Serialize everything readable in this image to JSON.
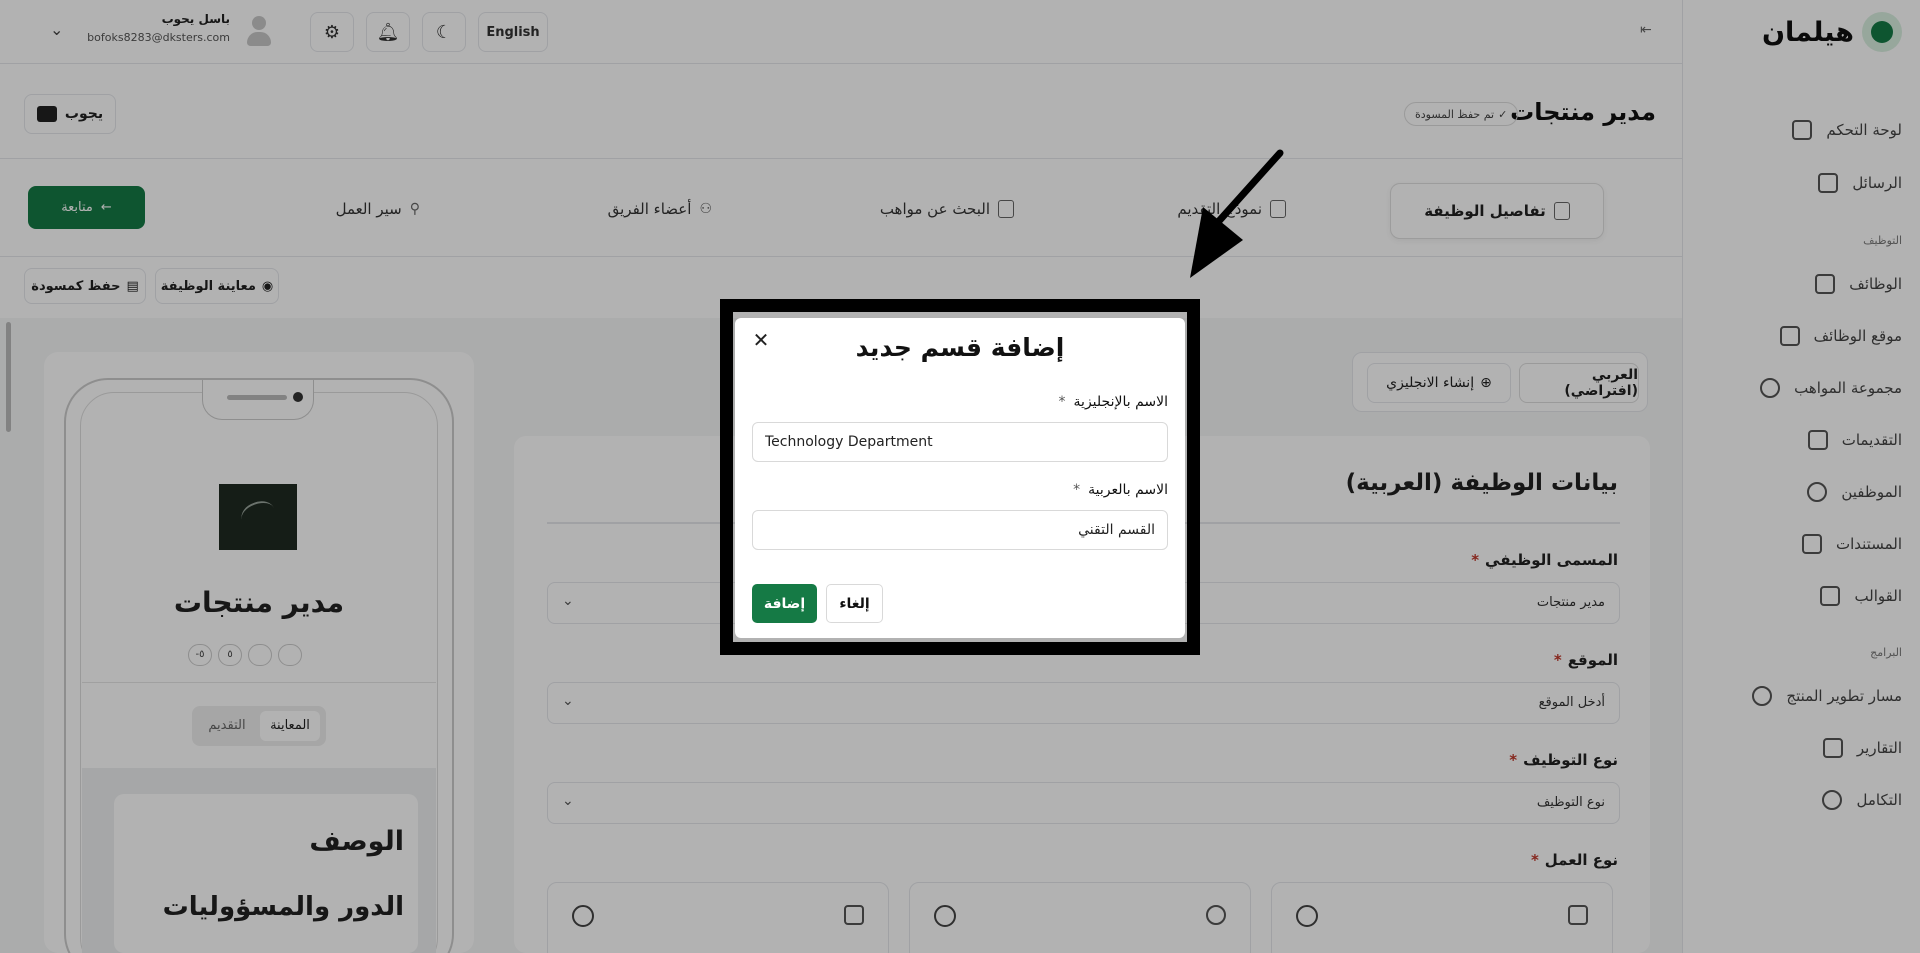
{
  "sidebar": {
    "brand": "هيلمان",
    "items": [
      {
        "label": "لوحة التحكم",
        "icon": "dashboard-icon"
      },
      {
        "label": "الرسائل",
        "icon": "mail-icon"
      },
      {
        "label": "الوظائف",
        "icon": "briefcase-icon"
      },
      {
        "label": "موقع الوظائف",
        "icon": "monitor-icon"
      },
      {
        "label": "مجموعة المواهب",
        "icon": "compass-icon"
      },
      {
        "label": "التقديمات",
        "icon": "store-icon"
      },
      {
        "label": "الموظفين",
        "icon": "person-icon"
      },
      {
        "label": "المستندات",
        "icon": "document-icon"
      },
      {
        "label": "القوالب",
        "icon": "template-icon"
      },
      {
        "label": "مسار تطوير المنتج",
        "icon": "hand-icon"
      },
      {
        "label": "التقارير",
        "icon": "filter-icon"
      },
      {
        "label": "التكامل",
        "icon": "link-icon"
      }
    ],
    "sections": [
      "التوظيف",
      "البرامج"
    ]
  },
  "topbar": {
    "language": "English",
    "user_name": "باسل يحوب",
    "user_email": "bofoks8283@dksters.com"
  },
  "page": {
    "title": "مدير منتجات",
    "draft_badge": "تم حفظ المسودة",
    "back_label": "يجوب"
  },
  "steps": {
    "active": "تفاصيل الوظيفة",
    "items": [
      "نموذج التقديم",
      "البحث عن مواهب",
      "أعضاء الفريق",
      "سير العمل"
    ],
    "next_label": "متابعة"
  },
  "actions": {
    "preview": "معاينة الوظيفة",
    "save_draft": "حفظ كمسودة"
  },
  "preview": {
    "title": "مدير منتجات",
    "chips": [
      "-٥",
      "٥",
      "",
      ""
    ],
    "tab_preview": "المعاينة",
    "tab_apply": "التقديم",
    "desc_heading": "الوصف",
    "role_heading": "الدور والمسؤوليات"
  },
  "form": {
    "lang_tab_default": "العربي (افتراضي)",
    "lang_tab_create": "إنشاء الانجليزي",
    "title": "بيانات الوظيفة (العربية)",
    "job_title_label": "المسمى الوظيفي",
    "job_title_value": "مدير منتجات",
    "location_label": "الموقع",
    "location_placeholder": "أدخل الموقع",
    "employment_type_label": "نوع التوظيف",
    "employment_type_placeholder": "نوع التوظيف",
    "work_type_label": "نوع العمل",
    "required_mark": "*"
  },
  "modal": {
    "title": "إضافة قسم جديد",
    "en_label": "الاسم بالإنجليزية",
    "en_value": "Technology Department",
    "ar_label": "الاسم بالعربية",
    "ar_value": "القسم التقني",
    "required_mark": "*",
    "add_label": "إضافة",
    "cancel_label": "إلغاء",
    "close_glyph": "✕"
  },
  "colors": {
    "brand_green": "#157a45",
    "annotation": "#000000"
  }
}
